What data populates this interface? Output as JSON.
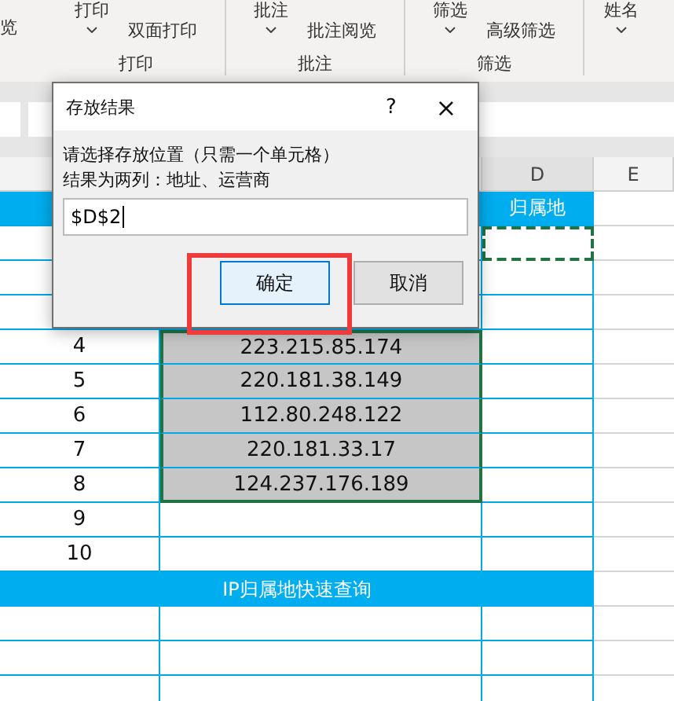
{
  "ribbon": {
    "left_fragment": "览",
    "groups": [
      {
        "top_label": "打印",
        "button": "双面打印",
        "name": "打印"
      },
      {
        "top_label": "批注",
        "button": "批注阅览",
        "name": "批注"
      },
      {
        "top_label": "筛选",
        "button": "高级筛选",
        "name": "筛选"
      },
      {
        "top_label": "姓名"
      }
    ]
  },
  "column_headers": [
    "D",
    "E"
  ],
  "header_row": {
    "column_d": "归属地"
  },
  "rows": [
    {
      "number": "4",
      "ip": "223.215.85.174",
      "selected": true
    },
    {
      "number": "5",
      "ip": "220.181.38.149",
      "selected": true
    },
    {
      "number": "6",
      "ip": "112.80.248.122",
      "selected": true
    },
    {
      "number": "7",
      "ip": "220.181.33.17",
      "selected": true
    },
    {
      "number": "8",
      "ip": "124.237.176.189",
      "selected": true
    },
    {
      "number": "9",
      "selected": false
    },
    {
      "number": "10",
      "selected": false
    }
  ],
  "footer_bar": "IP归属地快速查询",
  "dialog": {
    "title": "存放结果",
    "help": "?",
    "close": "×",
    "prompt": [
      "请选择存放位置（只需一个单元格）",
      "结果为两列：地址、运营商"
    ],
    "input_value": "$D$2",
    "buttons": [
      {
        "label": "确定",
        "default": true
      },
      {
        "label": "取消",
        "default": false
      }
    ]
  }
}
